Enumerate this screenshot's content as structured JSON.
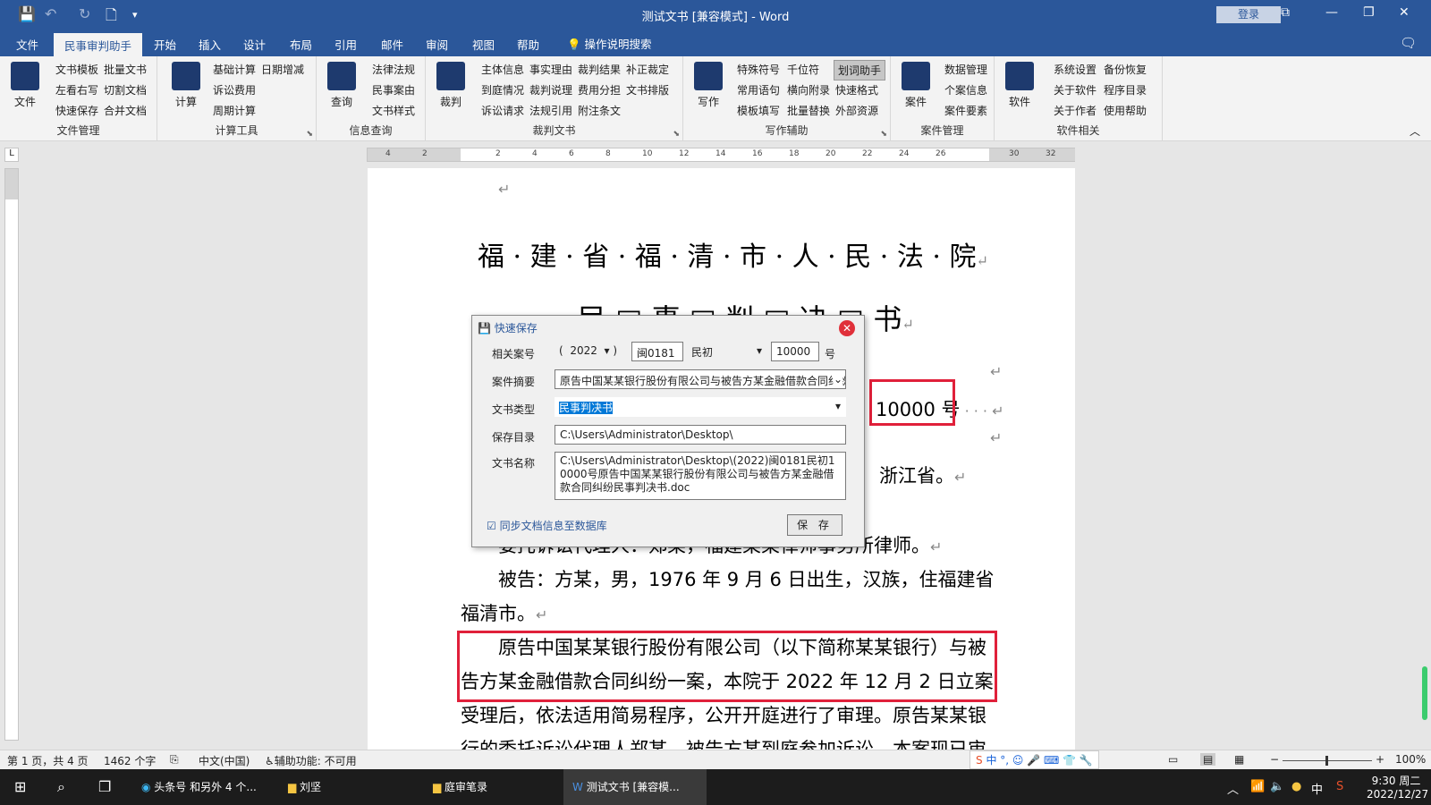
{
  "window": {
    "title": "测试文书 [兼容模式]  -  Word",
    "login": "登录"
  },
  "tabs": [
    "文件",
    "民事审判助手",
    "开始",
    "插入",
    "设计",
    "布局",
    "引用",
    "邮件",
    "审阅",
    "视图",
    "帮助"
  ],
  "tell_me": "操作说明搜索",
  "ribbon": {
    "g1": {
      "label": "文件管理",
      "big": "文件",
      "items": [
        "文书模板",
        "批量文书",
        "左看右写",
        "切割文档",
        "快速保存",
        "合并文档"
      ]
    },
    "g2": {
      "label": "计算工具",
      "big": "计算",
      "items": [
        "基础计算",
        "日期增减",
        "诉讼费用",
        "周期计算"
      ]
    },
    "g3": {
      "label": "信息查询",
      "big": "查询",
      "items": [
        "法律法规",
        "民事案由",
        "文书样式"
      ]
    },
    "g4": {
      "label": "裁判文书",
      "big": "裁判",
      "items": [
        "主体信息",
        "事实理由",
        "裁判结果",
        "补正裁定",
        "到庭情况",
        "裁判说理",
        "费用分担",
        "文书排版",
        "诉讼请求",
        "法规引用",
        "附注条文"
      ]
    },
    "g5": {
      "label": "写作辅助",
      "big": "写作",
      "items": [
        "特殊符号",
        "千位符",
        "划词助手",
        "常用语句",
        "横向附录",
        "快速格式",
        "模板填写",
        "批量替换",
        "外部资源"
      ]
    },
    "g6": {
      "label": "案件管理",
      "big": "案件",
      "items": [
        "数据管理",
        "个案信息",
        "案件要素"
      ]
    },
    "g7": {
      "label": "软件相关",
      "big": "软件",
      "items": [
        "系统设置",
        "备份恢复",
        "关于软件",
        "程序目录",
        "关于作者",
        "使用帮助"
      ]
    }
  },
  "ruler": {
    "ticks": [
      "4",
      "2",
      "",
      "2",
      "4",
      "6",
      "8",
      "10",
      "12",
      "14",
      "16",
      "18",
      "20",
      "22",
      "24",
      "26",
      "",
      "30",
      "32"
    ]
  },
  "document": {
    "court": "福 · 建 · 省 · 福 · 清 · 市 · 人 · 民 · 法 · 院",
    "doctype": "民 □ 事 □ 判 □ 决 □ 书",
    "case_no_fragment": "10000 号",
    "p_zhejiang": "浙江省。",
    "p_lawyer": "委托诉讼代理人：郑某，福建某某律师事务所律师。",
    "p_defendant1": "被告：方某，男，1976 年 9 月 6 日出生，汉族，住福建省",
    "p_defendant2": "福清市。",
    "p_case1": "原告中国某某银行股份有限公司（以下简称某某银行）与被",
    "p_case2": "告方某金融借款合同纠纷一案，本院于 2022 年 12 月 2 日立案",
    "p_case3": "受理后，依法适用简易程序，公开开庭进行了审理。原告某某银",
    "p_case4": "行的委托诉讼代理人郑某，被告方某到庭参加诉讼。本案现已审"
  },
  "dialog": {
    "title": "快速保存",
    "label_case": "相关案号",
    "year": "2022",
    "court_code": "闽0181",
    "case_type": "民初",
    "case_number": "10000",
    "hao": "号",
    "label_summary": "案件摘要",
    "summary": "原告中国某某银行股份有限公司与被告方某金融借款合同纠纷",
    "label_doctype": "文书类型",
    "doctype": "民事判决书",
    "label_dir": "保存目录",
    "dir": "C:\\Users\\Administrator\\Desktop\\",
    "label_name": "文书名称",
    "filename": "C:\\Users\\Administrator\\Desktop\\(2022)闽0181民初10000号原告中国某某银行股份有限公司与被告方某金融借款合同纠纷民事判决书.doc",
    "sync": "同步文档信息至数据库",
    "save": "保 存"
  },
  "status": {
    "page": "第 1 页，共 4 页",
    "words": "1462 个字",
    "lang": "中文(中国)",
    "access": "辅助功能: 不可用",
    "zoom": "100%"
  },
  "taskbar": {
    "app1": "头条号 和另外 4 个...",
    "app2": "刘坚",
    "app3": "庭审笔录",
    "app4": "测试文书 [兼容模...",
    "ime": "中",
    "time": "9:30 周二",
    "date": "2022/12/27"
  }
}
